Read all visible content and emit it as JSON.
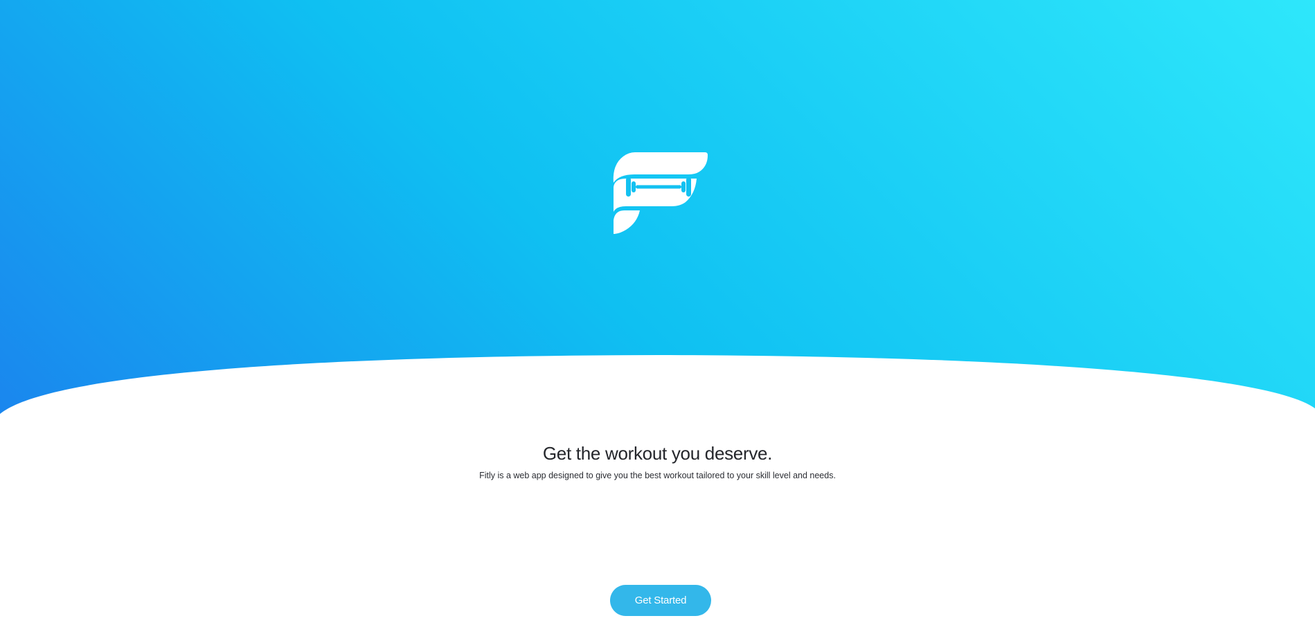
{
  "brand": {
    "logo_icon": "fitly-dumbbell-f-logo",
    "colors": {
      "gradient_start": "#1a86ee",
      "gradient_mid": "#0fc0f2",
      "gradient_end": "#2ee7fb",
      "accent": "#33b7ea",
      "text": "#24262b"
    }
  },
  "hero": {
    "headline": "Get the workout you deserve.",
    "description": "Fitly is a web app designed to give you the best workout tailored to your skill level and needs."
  },
  "cta": {
    "label": "Get Started"
  }
}
